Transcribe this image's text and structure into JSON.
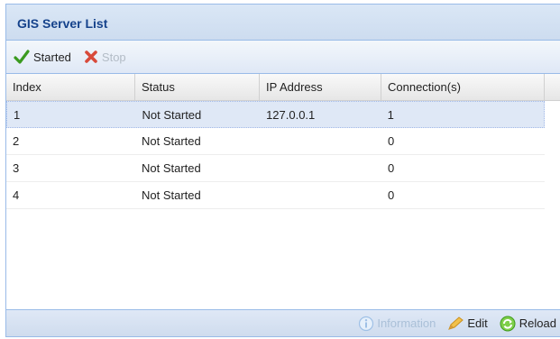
{
  "panel": {
    "title": "GIS Server List"
  },
  "toolbar": {
    "started_label": "Started",
    "started_icon": "checkmark-icon",
    "stop_label": "Stop",
    "stop_icon": "x-icon",
    "stop_disabled": true
  },
  "grid": {
    "columns": [
      "Index",
      "Status",
      "IP Address",
      "Connection(s)"
    ],
    "rows": [
      {
        "index": "1",
        "status": "Not Started",
        "ip": "127.0.0.1",
        "connections": "1",
        "selected": true
      },
      {
        "index": "2",
        "status": "Not Started",
        "ip": "",
        "connections": "0",
        "selected": false
      },
      {
        "index": "3",
        "status": "Not Started",
        "ip": "",
        "connections": "0",
        "selected": false
      },
      {
        "index": "4",
        "status": "Not Started",
        "ip": "",
        "connections": "0",
        "selected": false
      }
    ]
  },
  "footer": {
    "information_label": "Information",
    "information_disabled": true,
    "edit_label": "Edit",
    "reload_label": "Reload"
  },
  "colors": {
    "title_text": "#15428b",
    "panel_border": "#99bbe8",
    "selected_row": "#dfe8f6",
    "check_green": "#3a9a1f",
    "stop_red": "#d84a3a"
  }
}
